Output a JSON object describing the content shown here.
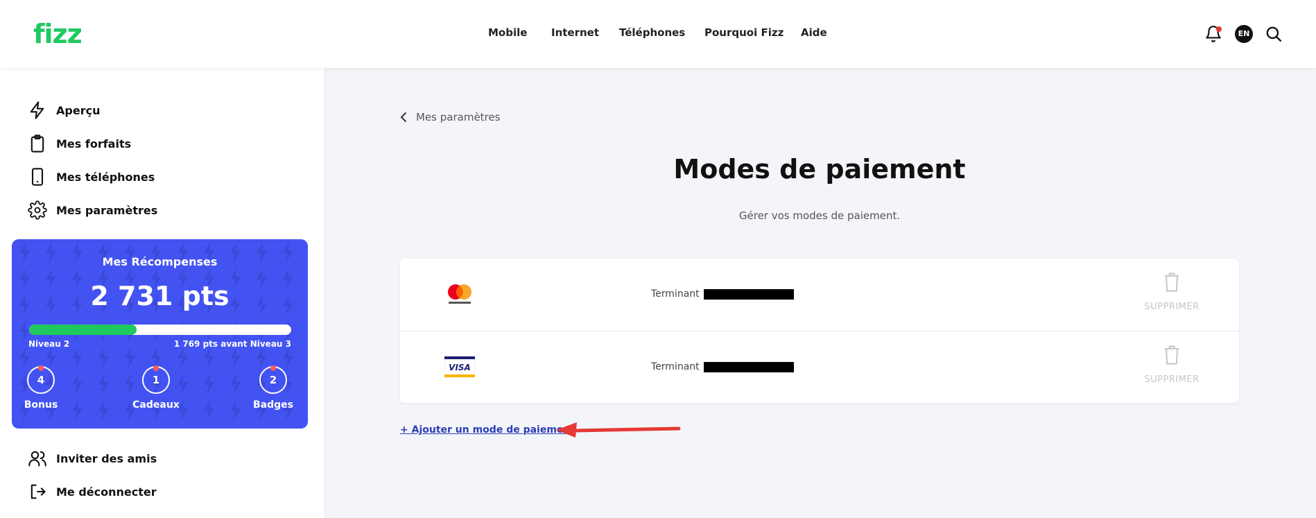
{
  "header": {
    "logo": "fizz",
    "nav": [
      "Mobile",
      "Internet",
      "Téléphones",
      "Pourquoi Fizz",
      "Aide"
    ],
    "lang": "EN"
  },
  "sidebar": {
    "items": [
      {
        "label": "Aperçu",
        "icon": "bolt-icon"
      },
      {
        "label": "Mes forfaits",
        "icon": "clipboard-icon"
      },
      {
        "label": "Mes téléphones",
        "icon": "phone-icon"
      },
      {
        "label": "Mes paramètres",
        "icon": "gear-icon"
      }
    ],
    "bottom_items": [
      {
        "label": "Inviter des amis",
        "icon": "users-icon"
      },
      {
        "label": "Me déconnecter",
        "icon": "logout-icon"
      }
    ]
  },
  "rewards": {
    "title": "Mes Récompenses",
    "points": "2 731 pts",
    "progress": 0.41,
    "level_left": "Niveau 2",
    "level_right": "1 769 pts avant Niveau 3",
    "badges": [
      {
        "count": "4",
        "label": "Bonus"
      },
      {
        "count": "1",
        "label": "Cadeaux"
      },
      {
        "count": "2",
        "label": "Badges"
      }
    ]
  },
  "main": {
    "back": "Mes paramètres",
    "title": "Modes de paiement",
    "subtitle": "Gérer vos modes de paiement.",
    "payment_methods": [
      {
        "brand": "mastercard",
        "ending_label": "Terminant",
        "delete_label": "SUPPRIMER"
      },
      {
        "brand": "visa",
        "ending_label": "Terminant",
        "delete_label": "SUPPRIMER"
      }
    ],
    "add_label": "+ Ajouter un mode de paiement"
  },
  "colors": {
    "accent_green": "#1fc95f",
    "rewards_blue": "#4353f2",
    "link_blue": "#2b3db8",
    "annotation_red": "#e53935"
  }
}
